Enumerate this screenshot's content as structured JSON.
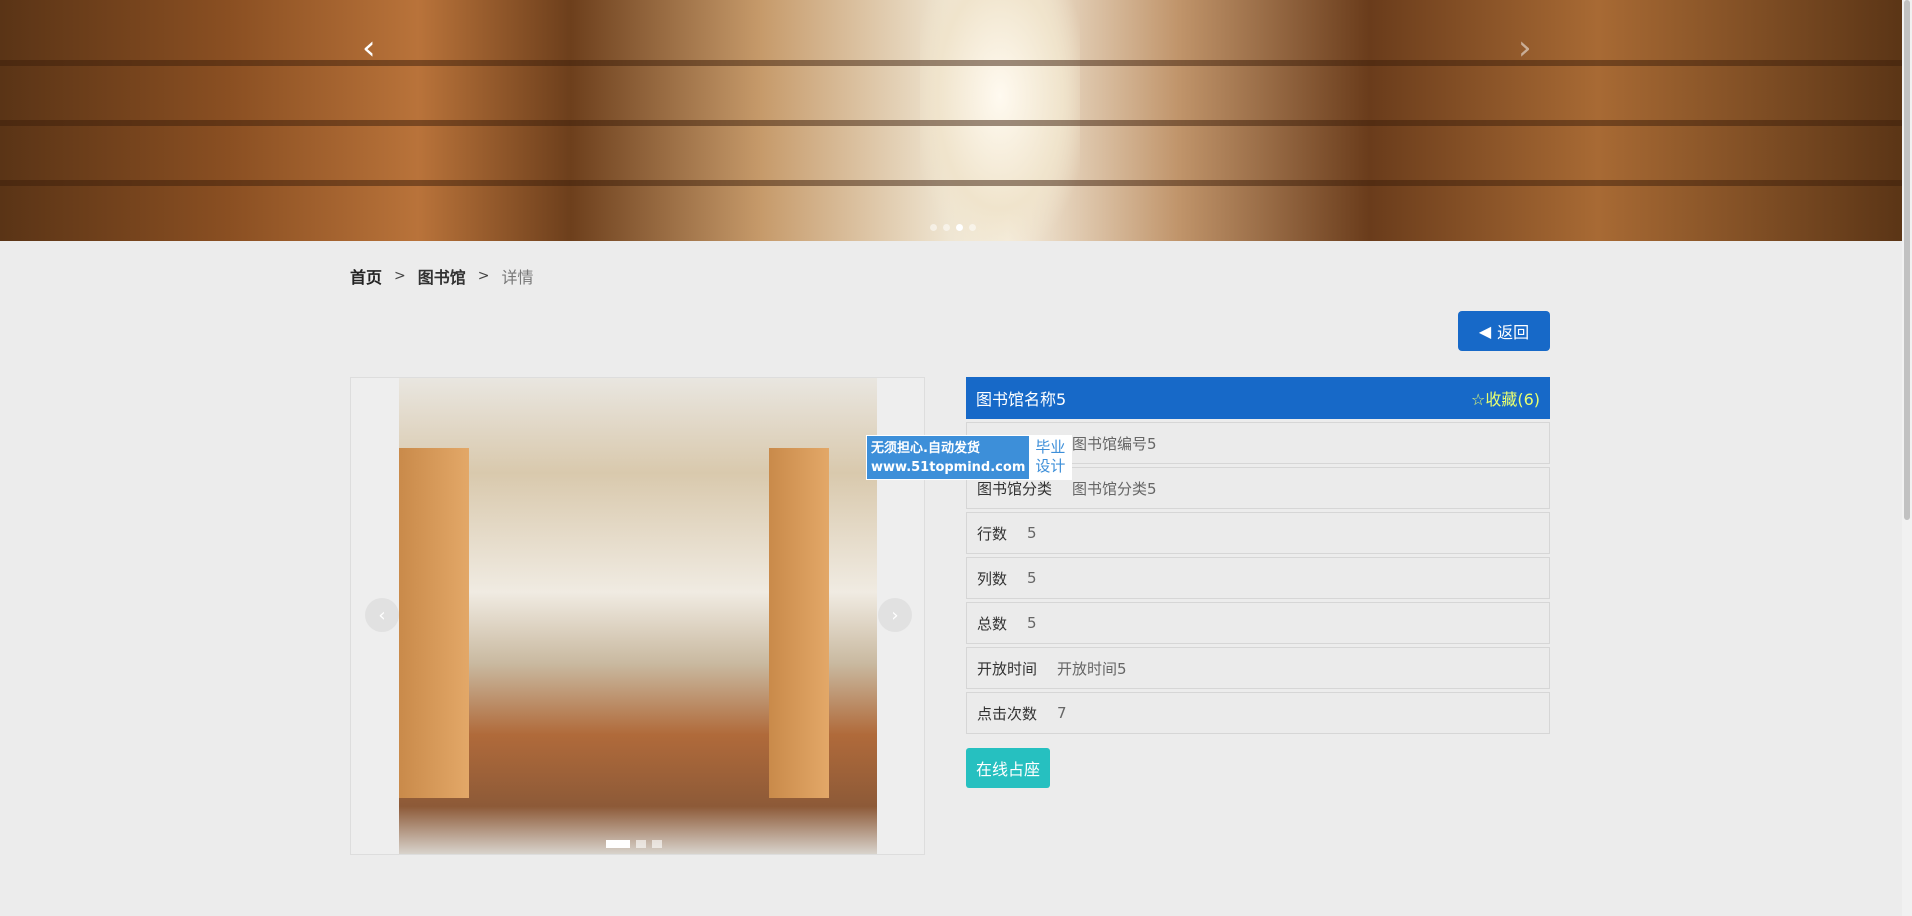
{
  "banner": {
    "prev_icon": "chevron-left",
    "next_icon": "chevron-right",
    "slides": 4,
    "active_slide": 3
  },
  "breadcrumb": {
    "home": "首页",
    "library": "图书馆",
    "separator": ">",
    "current": "详情"
  },
  "back_button": {
    "label": "返回",
    "icon": "caret-left"
  },
  "gallery": {
    "prev_icon": "chevron-left",
    "next_icon": "chevron-right",
    "slides": 3,
    "active_slide": 1
  },
  "detail": {
    "title": "图书馆名称5",
    "favorite": {
      "icon": "star-outline",
      "label": "收藏(6)"
    },
    "rows": [
      {
        "label": "图书馆编号",
        "value": "图书馆编号5"
      },
      {
        "label": "图书馆分类",
        "value": "图书馆分类5"
      },
      {
        "label": "行数",
        "value": "5"
      },
      {
        "label": "列数",
        "value": "5"
      },
      {
        "label": "总数",
        "value": "5"
      },
      {
        "label": "开放时间",
        "value": "开放时间5"
      },
      {
        "label": "点击次数",
        "value": "7"
      }
    ]
  },
  "seat_button": {
    "label": "在线占座"
  },
  "watermark": {
    "line1": "无须担心.自动发货",
    "line2": "www.51topmind.com",
    "badge1": "毕业",
    "badge2": "设计"
  },
  "colors": {
    "primary": "#1769c8",
    "seat": "#26c0c0",
    "favorite": "#e8ff70"
  }
}
